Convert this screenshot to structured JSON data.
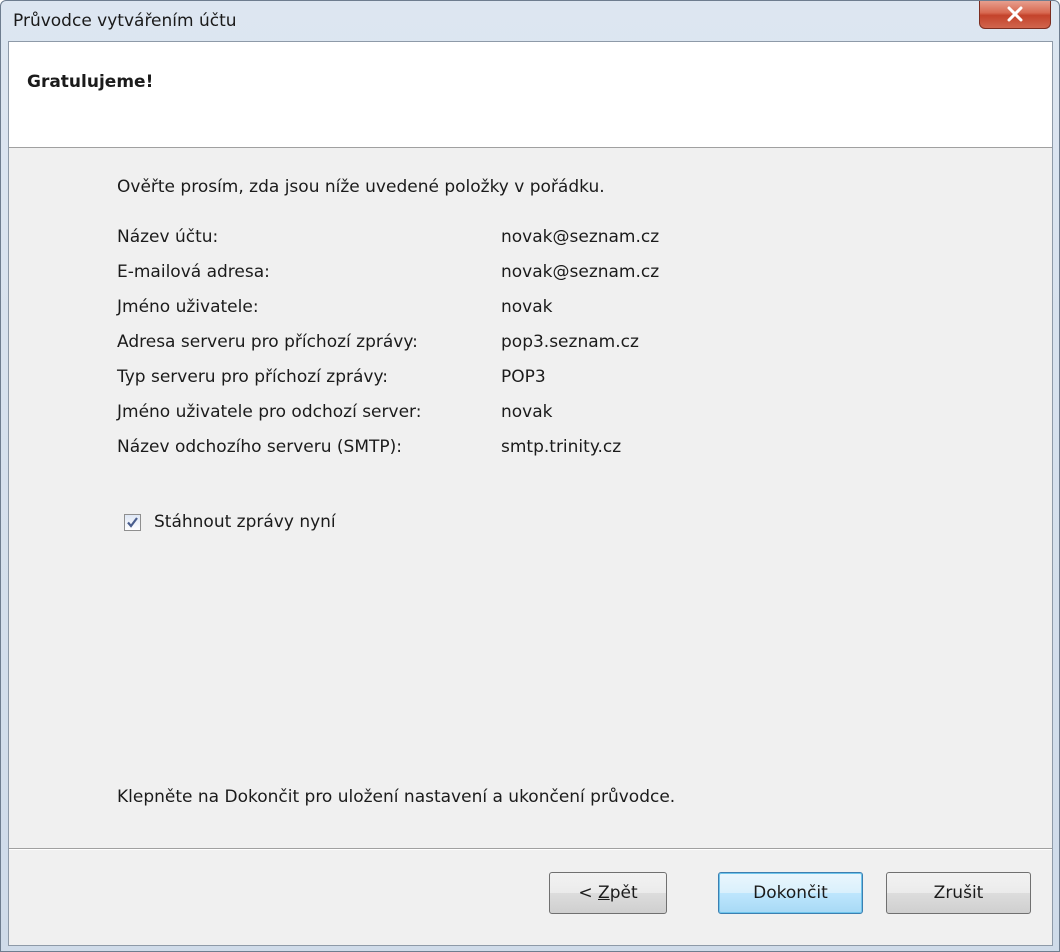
{
  "window": {
    "title": "Průvodce vytvářením účtu"
  },
  "header": {
    "title": "Gratulujeme!"
  },
  "intro": "Ověřte prosím, zda jsou níže uvedené položky v pořádku.",
  "details": [
    {
      "label": "Název účtu:",
      "value": "novak@seznam.cz"
    },
    {
      "label": "E-mailová adresa:",
      "value": "novak@seznam.cz"
    },
    {
      "label": "Jméno uživatele:",
      "value": "novak"
    },
    {
      "label": "Adresa serveru pro příchozí zprávy:",
      "value": "pop3.seznam.cz"
    },
    {
      "label": "Typ serveru pro příchozí zprávy:",
      "value": "POP3"
    },
    {
      "label": "Jméno uživatele pro odchozí server:",
      "value": "novak"
    },
    {
      "label": "Název odchozího serveru (SMTP):",
      "value": "smtp.trinity.cz"
    }
  ],
  "download_now": {
    "label": "Stáhnout zprávy nyní",
    "checked": true
  },
  "finish_note": "Klepněte na Dokončit pro uložení nastavení a ukončení průvodce.",
  "buttons": {
    "back_prefix": "< ",
    "back_mnemonic": "Z",
    "back_rest": "pět",
    "finish": "Dokončit",
    "cancel": "Zrušit"
  },
  "icons": {
    "close": "close-icon",
    "check": "checkmark-icon"
  }
}
